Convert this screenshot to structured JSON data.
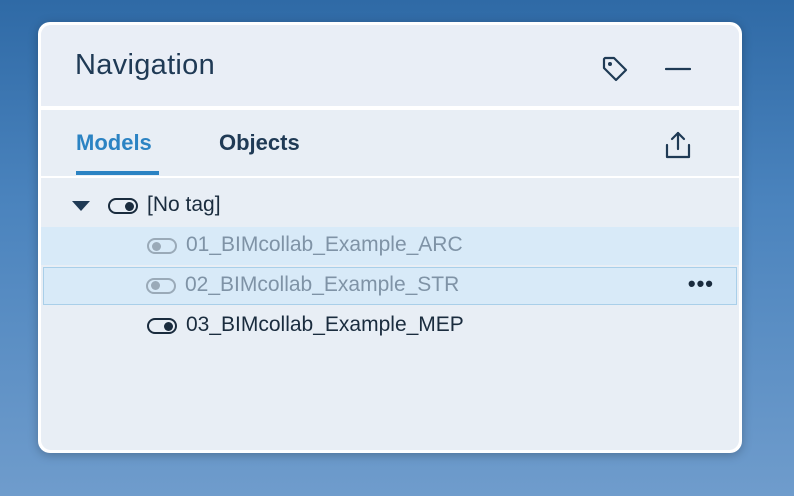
{
  "panel": {
    "title": "Navigation",
    "icons": {
      "tag": "tag-icon",
      "minimize": "minimize-icon",
      "export": "export-icon"
    }
  },
  "tabs": [
    {
      "label": "Models",
      "active": true
    },
    {
      "label": "Objects",
      "active": false
    }
  ],
  "tree": {
    "group_label": "[No tag]",
    "group_expanded": true,
    "group_visible": true,
    "items": [
      {
        "label": "01_BIMcollab_Example_ARC",
        "visible": false,
        "selected": true
      },
      {
        "label": "02_BIMcollab_Example_STR",
        "visible": false,
        "selected": true,
        "more_label": "•••"
      },
      {
        "label": "03_BIMcollab_Example_MEP",
        "visible": true,
        "selected": false
      }
    ]
  },
  "colors": {
    "accent": "#2b83c3",
    "text": "#1f3a55",
    "muted": "#7f93a6",
    "selection": "#d8eaf8"
  }
}
